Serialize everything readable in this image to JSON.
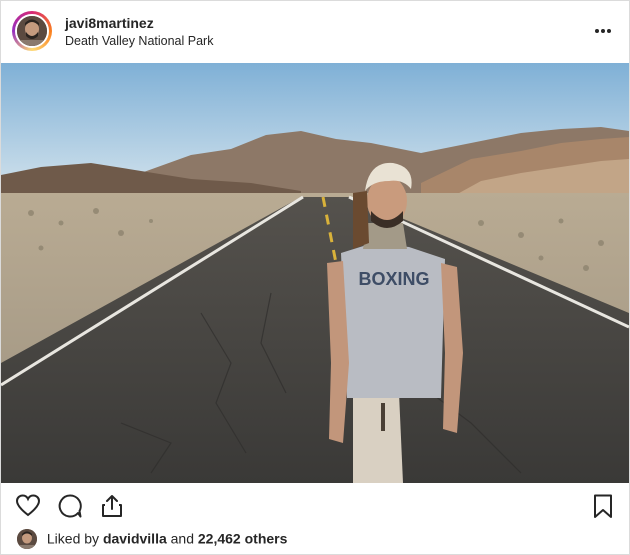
{
  "post": {
    "username": "javi8martinez",
    "location": "Death Valley National Park",
    "more_icon": "more-options-icon",
    "liked_by_prefix": "Liked by",
    "liked_by_user": "davidvilla",
    "liked_by_connector": "and",
    "liked_by_others": "22,462 others"
  },
  "photo": {
    "shirt_text": "BOXING"
  },
  "actions": {
    "icons": [
      "heart-icon",
      "comment-icon",
      "share-icon",
      "bookmark-icon"
    ]
  },
  "colors": {
    "text": "#262626",
    "border": "#dbdbdb",
    "sky": "#8fb8d8",
    "asphalt": "#3f3f3d"
  }
}
